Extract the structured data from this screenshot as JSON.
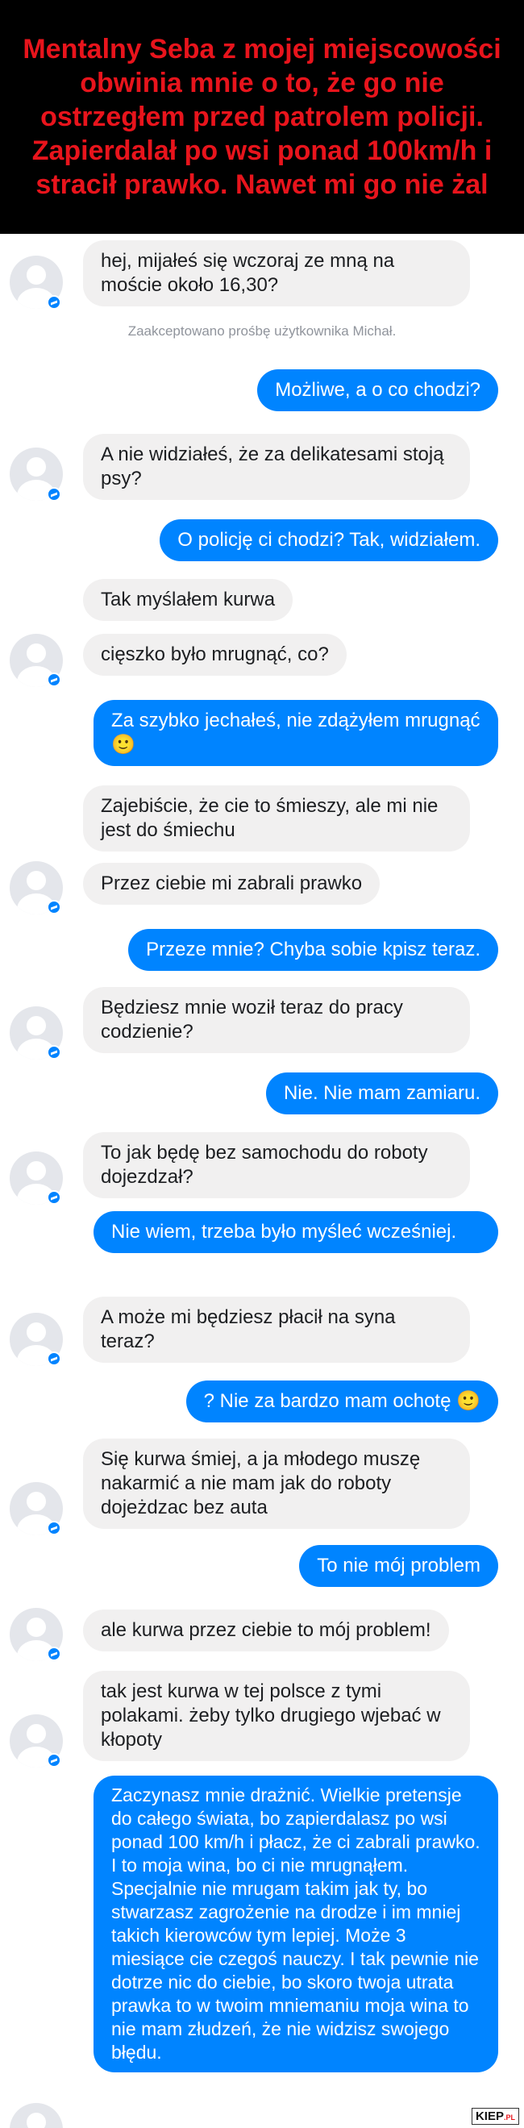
{
  "header": {
    "text": "Mentalny Seba z mojej miejscowości obwinia mnie o to, że go nie ostrzegłem przed patrolem policji. Zapierdalał po wsi ponad 100km/h i stracił prawko. Nawet mi go nie żal",
    "color": "#e8141c",
    "background": "#000000"
  },
  "colors": {
    "incoming": "#f1f0f0",
    "outgoing": "#0084ff"
  },
  "system_note": "Zaakceptowano prośbę użytkownika Michał.",
  "messages": [
    {
      "dir": "in",
      "text": "hej, mijałeś się wczoraj ze mną na moście około 16,30?"
    },
    {
      "dir": "out",
      "text": "Możliwe, a o co chodzi?"
    },
    {
      "dir": "in",
      "text": "A nie widziałeś, że za delikatesami stoją psy?"
    },
    {
      "dir": "out",
      "text": "O policję ci chodzi? Tak, widziałem."
    },
    {
      "dir": "in",
      "text": "Tak myślałem kurwa"
    },
    {
      "dir": "in",
      "text": "cięszko było mrugnąć, co?"
    },
    {
      "dir": "out",
      "text": "Za szybko jechałeś, nie zdążyłem mrugnąć 🙂"
    },
    {
      "dir": "in",
      "text": "Zajebiście, że cie to śmieszy, ale mi nie jest do śmiechu"
    },
    {
      "dir": "in",
      "text": "Przez ciebie mi zabrali prawko"
    },
    {
      "dir": "out",
      "text": "Przeze mnie? Chyba sobie kpisz teraz."
    },
    {
      "dir": "in",
      "text": "Będziesz mnie woził teraz do pracy codzienie?"
    },
    {
      "dir": "out",
      "text": "Nie. Nie mam zamiaru."
    },
    {
      "dir": "in",
      "text": "To jak będę bez samochodu do roboty dojezdzał?"
    },
    {
      "dir": "out",
      "text": "Nie wiem, trzeba było myśleć wcześniej."
    },
    {
      "dir": "in",
      "text": "A może mi będziesz płacił na syna teraz?"
    },
    {
      "dir": "out",
      "text": "? Nie za bardzo mam ochotę 🙂"
    },
    {
      "dir": "in",
      "text": "Się kurwa śmiej, a ja młodego muszę nakarmić a nie mam jak do roboty dojeżdzac bez auta"
    },
    {
      "dir": "out",
      "text": "To nie mój problem"
    },
    {
      "dir": "in",
      "text": "ale kurwa przez ciebie to mój problem!"
    },
    {
      "dir": "in",
      "text": "tak jest kurwa w tej polsce z tymi polakami. żeby tylko drugiego wjebać w kłopoty"
    },
    {
      "dir": "out",
      "text": "Zaczynasz mnie drażnić. Wielkie pretensje do całego świata, bo zapierdalasz po wsi ponad 100 km/h i płacz, że ci zabrali prawko. I to moja wina, bo ci nie mrugnąłem. Specjalnie nie mrugam takim jak ty, bo stwarzasz zagrożenie na drodze i im mniej takich kierowców tym lepiej. Może 3 miesiące cie czegoś nauczy. I tak pewnie nie dotrze nic do ciebie, bo skoro twoja utrata prawka to w twoim mniemaniu moja wina to nie mam złudzeń, że nie widzisz swojego błędu."
    }
  ],
  "watermark": {
    "brand": "KIEP",
    "suffix": ".PL"
  }
}
